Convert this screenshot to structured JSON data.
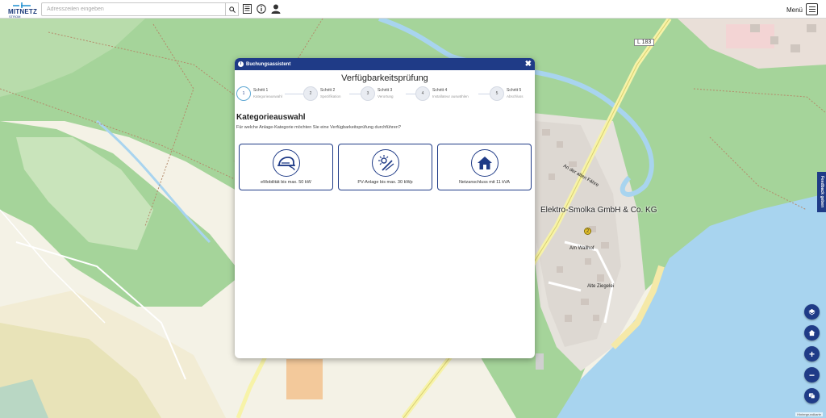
{
  "header": {
    "logo_text": "MITNETZ",
    "logo_sub": "STROM",
    "search_placeholder": "Adresszeilen eingeben",
    "search_icon": "search-icon",
    "list_icon": "list-icon",
    "info_icon": "info-icon",
    "user_icon": "user-icon",
    "menu_label": "Menü",
    "menu_icon": "hamburger-icon"
  },
  "map": {
    "company_label": "Elektro-Smolka GmbH & Co. KG",
    "road_shield": "L 183",
    "street_labels": [
      "Am Wallhof",
      "Alte Ziegelei",
      "Waldhofer Straße",
      "An der alten Fähre"
    ],
    "poi_label": "2"
  },
  "controls": {
    "feedback_label": "Feedback geben",
    "layers_icon": "layers-icon",
    "home_icon": "home-icon",
    "zoom_in_label": "+",
    "zoom_out_label": "−",
    "chat_icon": "chat-icon",
    "attribution": "Hintergrundkarte"
  },
  "modal": {
    "header_title": "Buchungsassistent",
    "close_label": "✖",
    "title": "Verfügbarkeitsprüfung",
    "steps": [
      {
        "number": "1",
        "name": "Schritt 1",
        "sub": "Kategorieauswahl",
        "active": true
      },
      {
        "number": "2",
        "name": "Schritt 2",
        "sub": "Spezifikation",
        "active": false
      },
      {
        "number": "3",
        "name": "Schritt 3",
        "sub": "Verortung",
        "active": false
      },
      {
        "number": "4",
        "name": "Schritt 4",
        "sub": "Installateur auswählen",
        "active": false
      },
      {
        "number": "5",
        "name": "Schritt 5",
        "sub": "Abschluss",
        "active": false
      }
    ],
    "section_title": "Kategorieauswahl",
    "section_question": "Für welche Anlage-Kategorie möchten Sie eine Verfügbarkeitsprüfung durchführen?",
    "categories": [
      {
        "label": "eMobilität bis max. 50 kW",
        "icon": "ev-car-icon"
      },
      {
        "label": "PV-Anlage bis max. 30 kWp",
        "icon": "solar-icon"
      },
      {
        "label": "Netzanschluss mit 11 kVA",
        "icon": "house-icon"
      }
    ]
  },
  "colors": {
    "brand": "#1f3b87",
    "forest": "#8fc98c",
    "water": "#a8d4ef",
    "active_step": "#5fa8d3"
  }
}
